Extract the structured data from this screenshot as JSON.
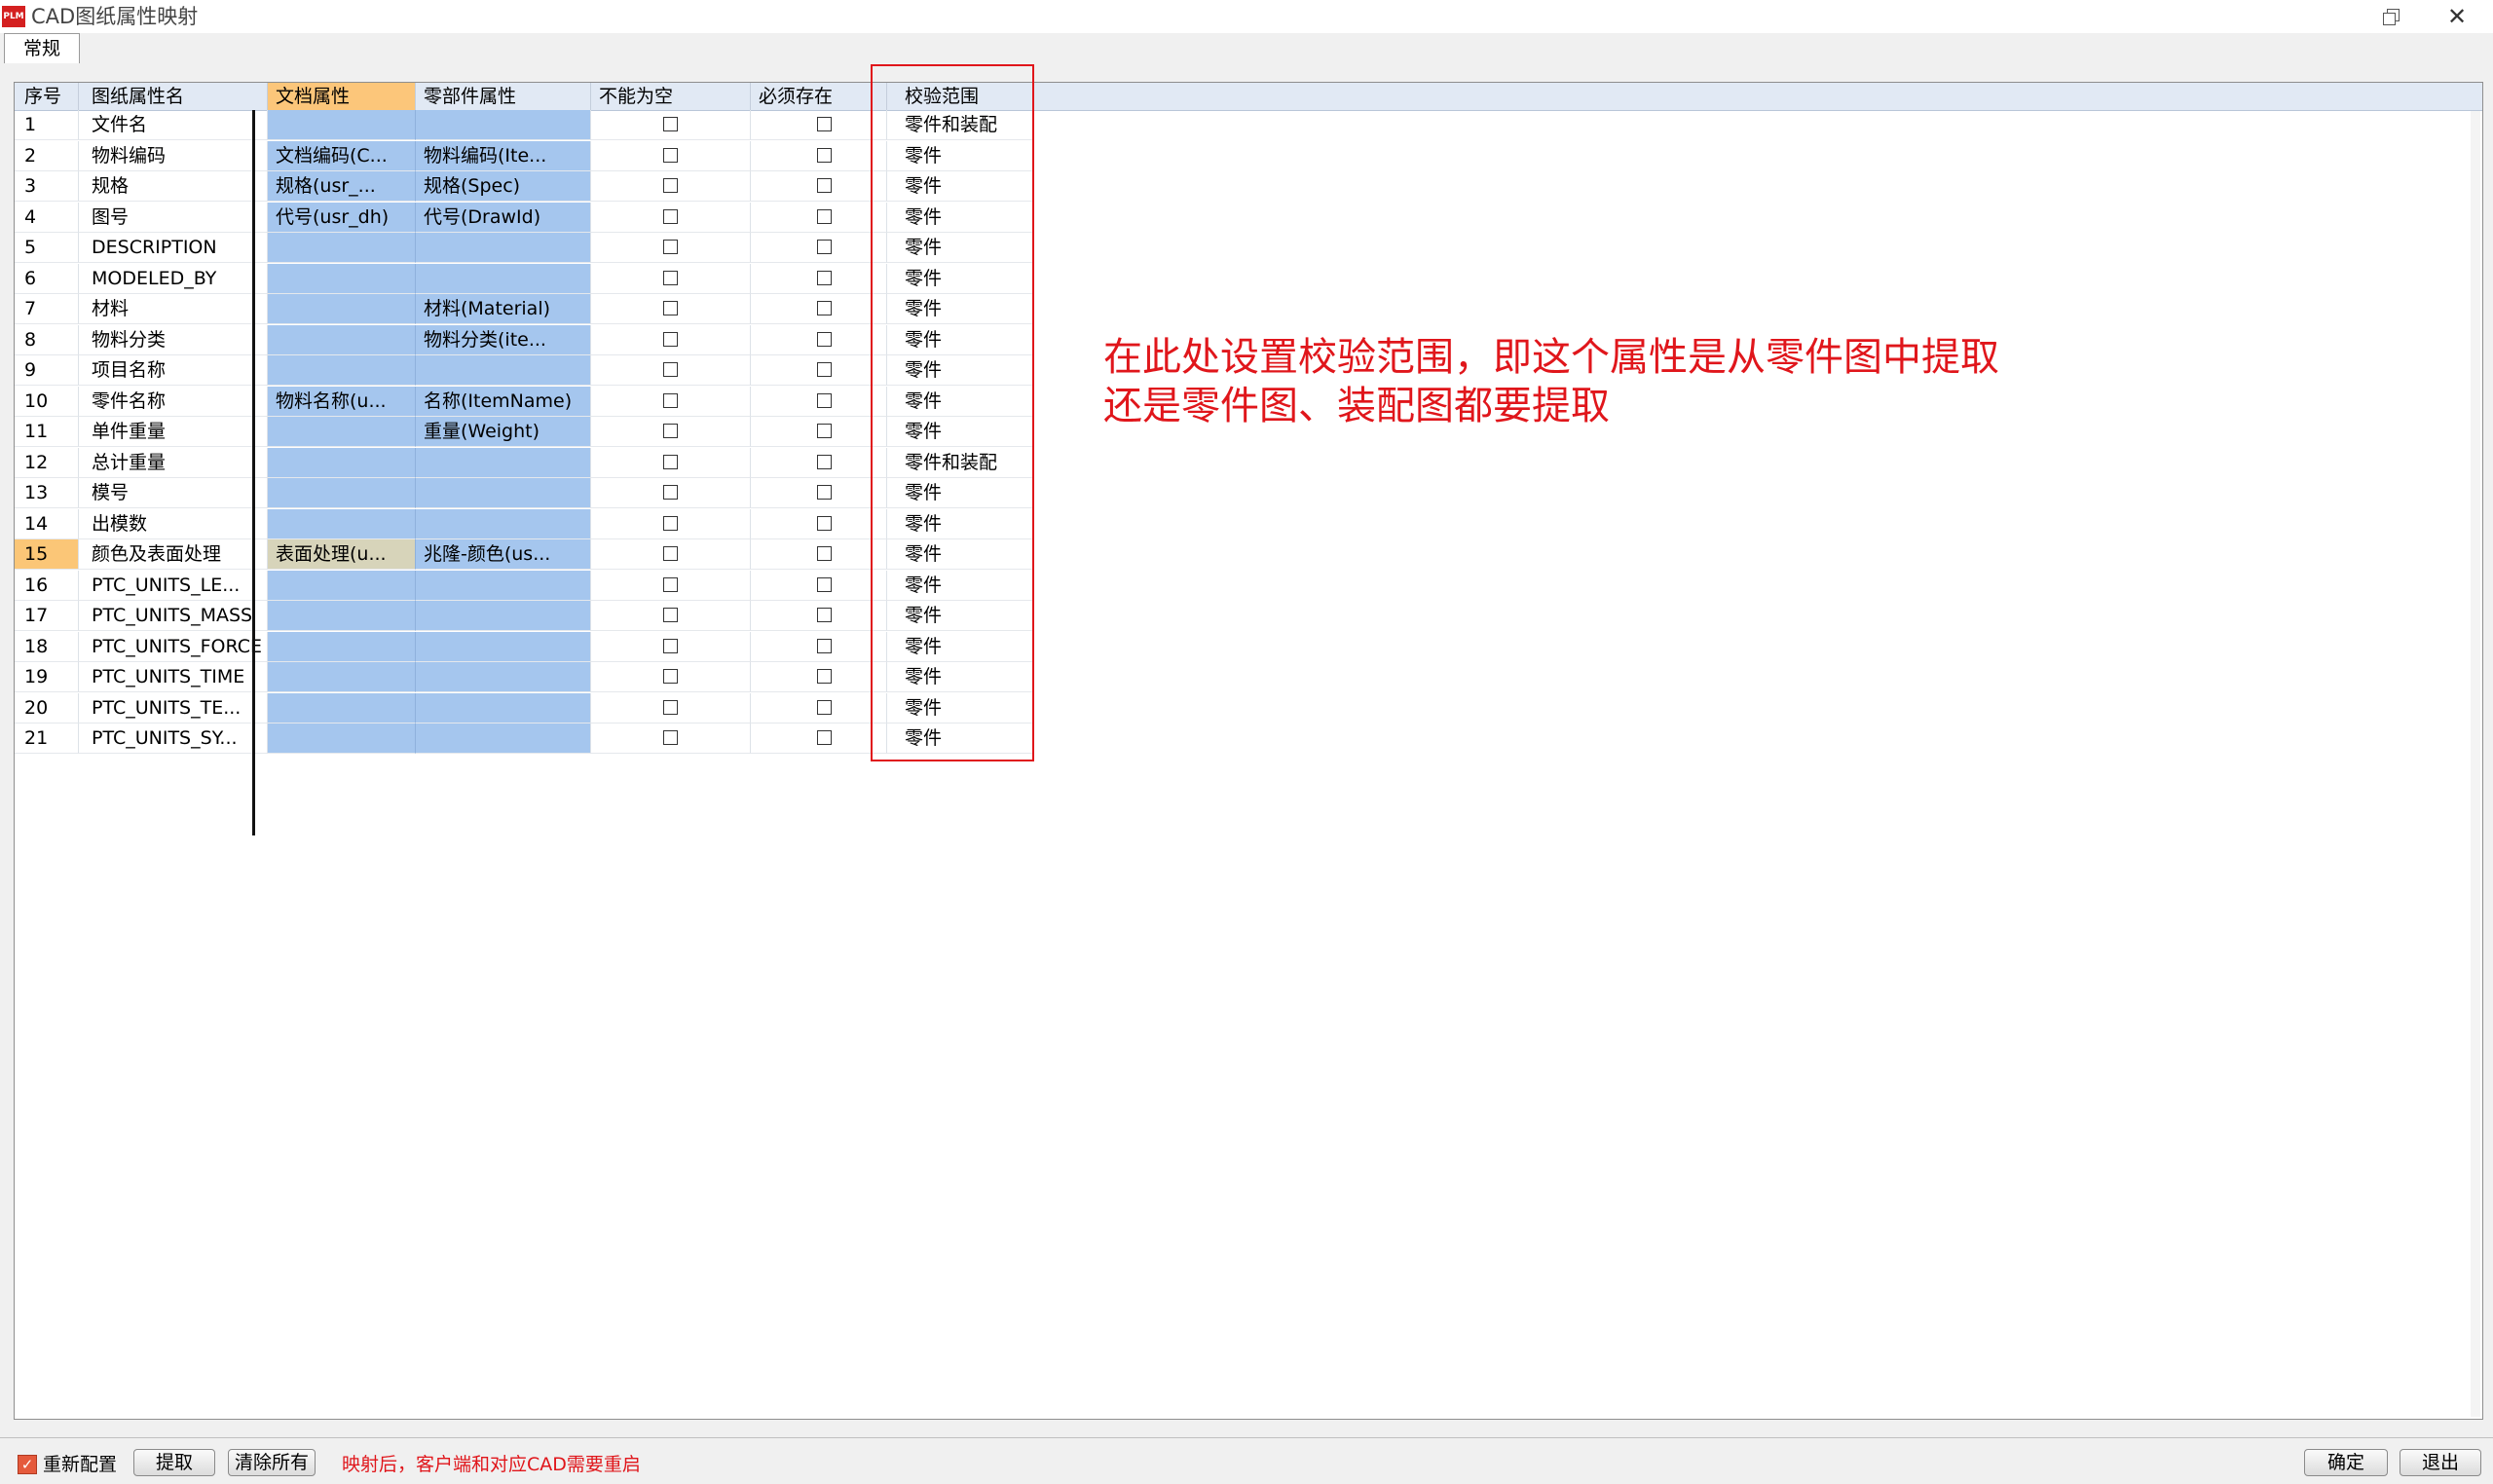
{
  "window": {
    "title": "CAD图纸属性映射",
    "logo_text": "PLM"
  },
  "tabs": [
    {
      "label": "常规"
    }
  ],
  "grid": {
    "columns": [
      "序号",
      "图纸属性名",
      "文档属性",
      "零部件属性",
      "不能为空",
      "必须存在",
      "校验范围"
    ],
    "active_column": 2,
    "selected_row": 15,
    "rows": [
      {
        "idx": "1",
        "name": "文件名",
        "doc": "",
        "part": "",
        "not_empty": false,
        "must_exist": false,
        "scope": "零件和装配"
      },
      {
        "idx": "2",
        "name": "物料编码",
        "doc": "文档编码(C...",
        "part": "物料编码(Ite...",
        "not_empty": false,
        "must_exist": false,
        "scope": "零件"
      },
      {
        "idx": "3",
        "name": "规格",
        "doc": "规格(usr_...",
        "part": "规格(Spec)",
        "not_empty": false,
        "must_exist": false,
        "scope": "零件"
      },
      {
        "idx": "4",
        "name": "图号",
        "doc": "代号(usr_dh)",
        "part": "代号(DrawId)",
        "not_empty": false,
        "must_exist": false,
        "scope": "零件"
      },
      {
        "idx": "5",
        "name": "DESCRIPTION",
        "doc": "",
        "part": "",
        "not_empty": false,
        "must_exist": false,
        "scope": "零件"
      },
      {
        "idx": "6",
        "name": "MODELED_BY",
        "doc": "",
        "part": "",
        "not_empty": false,
        "must_exist": false,
        "scope": "零件"
      },
      {
        "idx": "7",
        "name": "材料",
        "doc": "",
        "part": "材料(Material)",
        "not_empty": false,
        "must_exist": false,
        "scope": "零件"
      },
      {
        "idx": "8",
        "name": "物料分类",
        "doc": "",
        "part": "物料分类(ite...",
        "not_empty": false,
        "must_exist": false,
        "scope": "零件"
      },
      {
        "idx": "9",
        "name": "项目名称",
        "doc": "",
        "part": "",
        "not_empty": false,
        "must_exist": false,
        "scope": "零件"
      },
      {
        "idx": "10",
        "name": "零件名称",
        "doc": "物料名称(u...",
        "part": "名称(ItemName)",
        "not_empty": false,
        "must_exist": false,
        "scope": "零件"
      },
      {
        "idx": "11",
        "name": "单件重量",
        "doc": "",
        "part": "重量(Weight)",
        "not_empty": false,
        "must_exist": false,
        "scope": "零件"
      },
      {
        "idx": "12",
        "name": "总计重量",
        "doc": "",
        "part": "",
        "not_empty": false,
        "must_exist": false,
        "scope": "零件和装配"
      },
      {
        "idx": "13",
        "name": "模号",
        "doc": "",
        "part": "",
        "not_empty": false,
        "must_exist": false,
        "scope": "零件"
      },
      {
        "idx": "14",
        "name": "出模数",
        "doc": "",
        "part": "",
        "not_empty": false,
        "must_exist": false,
        "scope": "零件"
      },
      {
        "idx": "15",
        "name": "颜色及表面处理",
        "doc": "表面处理(u...",
        "part": "兆隆-颜色(us...",
        "not_empty": false,
        "must_exist": false,
        "scope": "零件"
      },
      {
        "idx": "16",
        "name": "PTC_UNITS_LE...",
        "doc": "",
        "part": "",
        "not_empty": false,
        "must_exist": false,
        "scope": "零件"
      },
      {
        "idx": "17",
        "name": "PTC_UNITS_MASS",
        "doc": "",
        "part": "",
        "not_empty": false,
        "must_exist": false,
        "scope": "零件"
      },
      {
        "idx": "18",
        "name": "PTC_UNITS_FORCE",
        "doc": "",
        "part": "",
        "not_empty": false,
        "must_exist": false,
        "scope": "零件"
      },
      {
        "idx": "19",
        "name": "PTC_UNITS_TIME",
        "doc": "",
        "part": "",
        "not_empty": false,
        "must_exist": false,
        "scope": "零件"
      },
      {
        "idx": "20",
        "name": "PTC_UNITS_TE...",
        "doc": "",
        "part": "",
        "not_empty": false,
        "must_exist": false,
        "scope": "零件"
      },
      {
        "idx": "21",
        "name": "PTC_UNITS_SY...",
        "doc": "",
        "part": "",
        "not_empty": false,
        "must_exist": false,
        "scope": "零件"
      }
    ]
  },
  "annotation": {
    "line1": "在此处设置校验范围，即这个属性是从零件图中提取",
    "line2": "还是零件图、装配图都要提取",
    "color": "#e0161b"
  },
  "footer": {
    "reconfigure_label": "重新配置",
    "reconfigure_checked": true,
    "extract_label": "提取",
    "clear_all_label": "清除所有",
    "note": "映射后，客户端和对应CAD需要重启",
    "ok_label": "确定",
    "exit_label": "退出"
  },
  "icons": {
    "restore": "restore-icon",
    "close": "close-icon",
    "checkbox_unchecked": "checkbox-icon",
    "checkbox_checked": "check-icon"
  }
}
